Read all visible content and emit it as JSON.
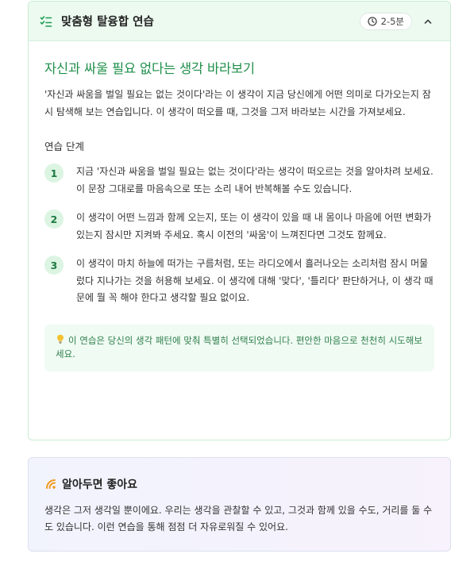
{
  "exercise_card": {
    "header": {
      "title": "맞춤형 탈융합 연습",
      "time_badge": "2-5분",
      "icon": "list-check-icon",
      "collapse_icon": "chevron-up-icon"
    },
    "title": "자신과 싸울 필요 없다는 생각 바라보기",
    "description": "'자신과 싸움을 벌일 필요는 없는 것이다'라는 이 생각이 지금 당신에게 어떤 의미로 다가오는지 잠시 탐색해 보는 연습입니다. 이 생각이 떠오를 때, 그것을 그저 바라보는 시간을 가져보세요.",
    "steps_heading": "연습 단계",
    "steps": [
      {
        "number": "1",
        "text": "지금 '자신과 싸움을 벌일 필요는 없는 것이다'라는 생각이 떠오르는 것을 알아차려 보세요. 이 문장 그대로를 마음속으로 또는 소리 내어 반복해볼 수도 있습니다."
      },
      {
        "number": "2",
        "text": "이 생각이 어떤 느낌과 함께 오는지, 또는 이 생각이 있을 때 내 몸이나 마음에 어떤 변화가 있는지 잠시만 지켜봐 주세요. 혹시 이전의 '싸움'이 느껴진다면 그것도 함께요."
      },
      {
        "number": "3",
        "text": "이 생각이 마치 하늘에 떠가는 구름처럼, 또는 라디오에서 흘러나오는 소리처럼 잠시 머물렀다 지나가는 것을 허용해 보세요. 이 생각에 대해 '맞다', '틀리다' 판단하거나, 이 생각 때문에 뭘 꼭 해야 한다고 생각할 필요 없이요."
      }
    ],
    "tip": {
      "icon": "lightbulb-icon",
      "text": "이 연습은 당신의 생각 패턴에 맞춰 특별히 선택되었습니다. 편안한 마음으로 천천히 시도해보세요."
    }
  },
  "info_card": {
    "icon": "sparkle-icon",
    "title": "알아두면 좋아요",
    "text": "생각은 그저 생각일 뿐이에요. 우리는 생각을 관찰할 수 있고, 그것과 함께 있을 수도, 거리를 둘 수도 있습니다. 이런 연습을 통해 점점 더 자유로워질 수 있어요."
  },
  "colors": {
    "accent_green": "#1f8f4a",
    "header_bg": "#ecfaef",
    "step_badge_bg": "#dcf5e3",
    "tip_bg": "#f0fbf3",
    "info_bg": "#f1f3fd"
  }
}
